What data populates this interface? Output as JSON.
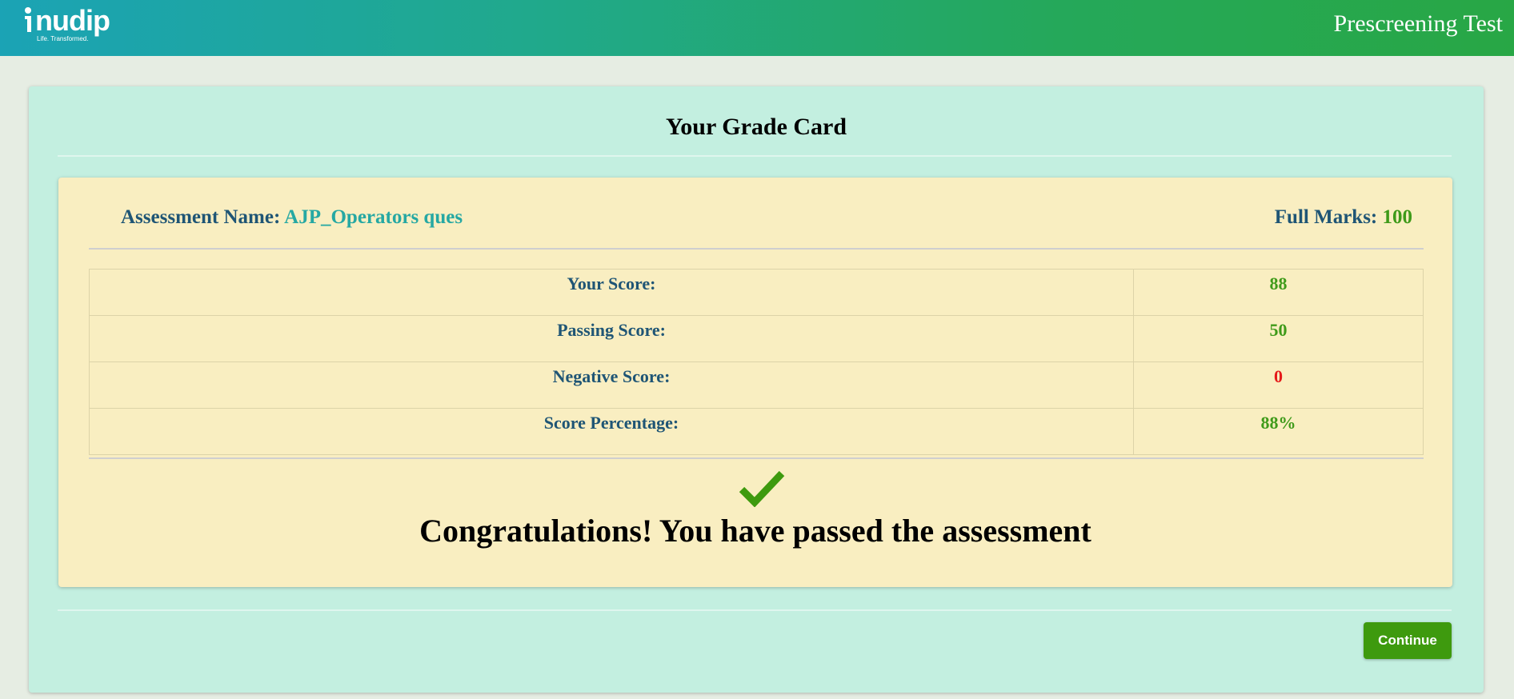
{
  "header": {
    "logo_text": "nudip",
    "logo_tagline": "Life. Transformed.",
    "title": "Prescreening Test"
  },
  "grade_card": {
    "title": "Your Grade Card",
    "assessment_label": "Assessment Name:",
    "assessment_name": "AJP_Operators ques",
    "full_marks_label": "Full Marks:",
    "full_marks_value": "100",
    "rows": [
      {
        "label": "Your Score:",
        "value": "88"
      },
      {
        "label": "Passing Score:",
        "value": "50"
      },
      {
        "label": "Negative Score:",
        "value": "0"
      },
      {
        "label": "Score Percentage:",
        "value": "88%"
      }
    ],
    "result_icon": "check-icon",
    "result_message": "Congratulations! You have passed the assessment"
  },
  "actions": {
    "continue_label": "Continue"
  },
  "colors": {
    "header_gradient_start": "#1ba3b5",
    "header_gradient_end": "#28a745",
    "outer_card": "#c3efe0",
    "inner_card": "#f9eec1",
    "label_text": "#1f5575",
    "value_green": "#3e9a19",
    "value_red": "#e51a1a",
    "assessment_name": "#26a8a3",
    "button": "#3e9a0e"
  }
}
